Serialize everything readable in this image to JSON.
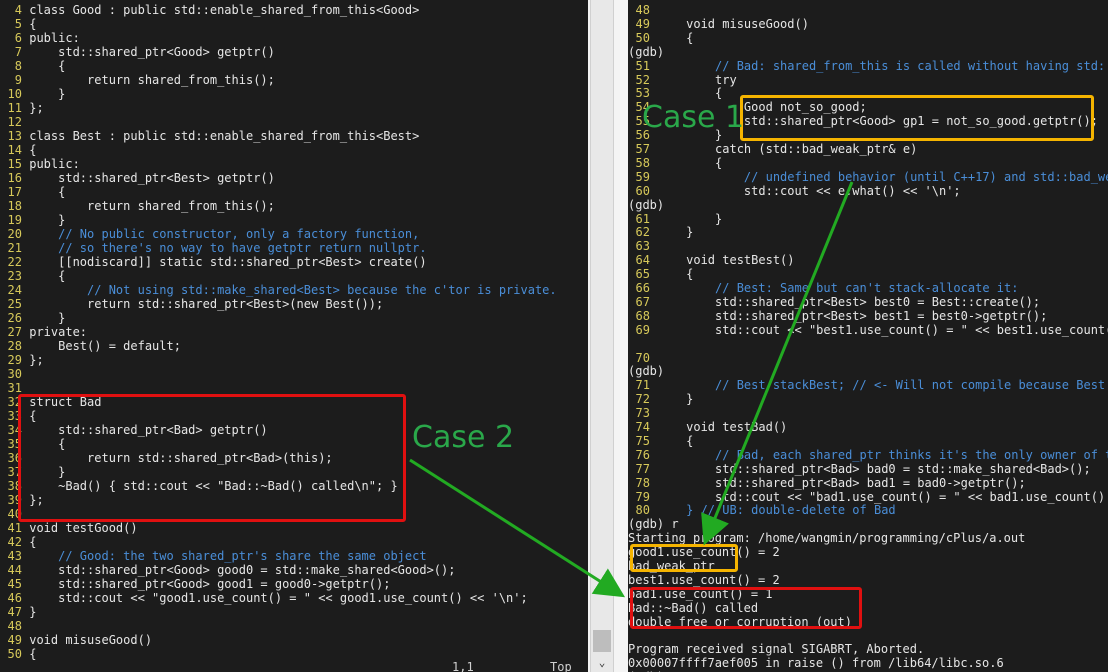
{
  "editor": {
    "lines": [
      {
        "n": "4",
        "t": "class Good : public std::enable_shared_from_this<Good>"
      },
      {
        "n": "5",
        "t": "{"
      },
      {
        "n": "6",
        "t": "public:"
      },
      {
        "n": "7",
        "t": "    std::shared_ptr<Good> getptr()"
      },
      {
        "n": "8",
        "t": "    {"
      },
      {
        "n": "9",
        "t": "        return shared_from_this();"
      },
      {
        "n": "10",
        "t": "    }"
      },
      {
        "n": "11",
        "t": "};"
      },
      {
        "n": "12",
        "t": ""
      },
      {
        "n": "13",
        "t": "class Best : public std::enable_shared_from_this<Best>"
      },
      {
        "n": "14",
        "t": "{"
      },
      {
        "n": "15",
        "t": "public:"
      },
      {
        "n": "16",
        "t": "    std::shared_ptr<Best> getptr()"
      },
      {
        "n": "17",
        "t": "    {"
      },
      {
        "n": "18",
        "t": "        return shared_from_this();"
      },
      {
        "n": "19",
        "t": "    }"
      },
      {
        "n": "20",
        "t": "    // No public constructor, only a factory function,",
        "c": "cm"
      },
      {
        "n": "21",
        "t": "    // so there's no way to have getptr return nullptr.",
        "c": "cm"
      },
      {
        "n": "22",
        "t": "    [[nodiscard]] static std::shared_ptr<Best> create()"
      },
      {
        "n": "23",
        "t": "    {"
      },
      {
        "n": "24",
        "t": "        // Not using std::make_shared<Best> because the c'tor is private.",
        "c": "cm"
      },
      {
        "n": "25",
        "t": "        return std::shared_ptr<Best>(new Best());"
      },
      {
        "n": "26",
        "t": "    }"
      },
      {
        "n": "27",
        "t": "private:"
      },
      {
        "n": "28",
        "t": "    Best() = default;"
      },
      {
        "n": "29",
        "t": "};"
      },
      {
        "n": "30",
        "t": ""
      },
      {
        "n": "31",
        "t": ""
      },
      {
        "n": "32",
        "t": "struct Bad"
      },
      {
        "n": "33",
        "t": "{"
      },
      {
        "n": "34",
        "t": "    std::shared_ptr<Bad> getptr()"
      },
      {
        "n": "35",
        "t": "    {"
      },
      {
        "n": "36",
        "t": "        return std::shared_ptr<Bad>(this);"
      },
      {
        "n": "37",
        "t": "    }"
      },
      {
        "n": "38",
        "t": "    ~Bad() { std::cout << \"Bad::~Bad() called\\n\"; }"
      },
      {
        "n": "39",
        "t": "};"
      },
      {
        "n": "40",
        "t": ""
      },
      {
        "n": "41",
        "t": "void testGood()"
      },
      {
        "n": "42",
        "t": "{"
      },
      {
        "n": "43",
        "t": "    // Good: the two shared_ptr's share the same object",
        "c": "cm"
      },
      {
        "n": "44",
        "t": "    std::shared_ptr<Good> good0 = std::make_shared<Good>();"
      },
      {
        "n": "45",
        "t": "    std::shared_ptr<Good> good1 = good0->getptr();"
      },
      {
        "n": "46",
        "t": "    std::cout << \"good1.use_count() = \" << good1.use_count() << '\\n';"
      },
      {
        "n": "47",
        "t": "}"
      },
      {
        "n": "48",
        "t": ""
      },
      {
        "n": "49",
        "t": "void misuseGood()"
      },
      {
        "n": "50",
        "t": "{"
      }
    ],
    "status_position": "1,1",
    "status_scroll": "Top"
  },
  "gdb": {
    "lines": [
      {
        "n": "48",
        "t": ""
      },
      {
        "n": "49",
        "t": "    void misuseGood()"
      },
      {
        "n": "50",
        "t": "    {"
      },
      {
        "n": "",
        "t": "(gdb)"
      },
      {
        "n": "51",
        "t": "        // Bad: shared_from_this is called without having std::s",
        "c": "cm"
      },
      {
        "n": "52",
        "t": "        try"
      },
      {
        "n": "53",
        "t": "        {"
      },
      {
        "n": "54",
        "t": "            Good not_so_good;"
      },
      {
        "n": "55",
        "t": "            std::shared_ptr<Good> gp1 = not_so_good.getptr();"
      },
      {
        "n": "56",
        "t": "        }"
      },
      {
        "n": "57",
        "t": "        catch (std::bad_weak_ptr& e)"
      },
      {
        "n": "58",
        "t": "        {"
      },
      {
        "n": "59",
        "t": "            // undefined behavior (until C++17) and std::bad_wea",
        "c": "cm"
      },
      {
        "n": "60",
        "t": "            std::cout << e.what() << '\\n';"
      },
      {
        "n": "",
        "t": "(gdb)"
      },
      {
        "n": "61",
        "t": "        }"
      },
      {
        "n": "62",
        "t": "    }"
      },
      {
        "n": "63",
        "t": ""
      },
      {
        "n": "64",
        "t": "    void testBest()"
      },
      {
        "n": "65",
        "t": "    {"
      },
      {
        "n": "66",
        "t": "        // Best: Same but can't stack-allocate it:",
        "c": "cm"
      },
      {
        "n": "67",
        "t": "        std::shared_ptr<Best> best0 = Best::create();"
      },
      {
        "n": "68",
        "t": "        std::shared_ptr<Best> best1 = best0->getptr();"
      },
      {
        "n": "69",
        "t": "        std::cout << \"best1.use_count() = \" << best1.use_count()"
      },
      {
        "n": "",
        "t": ""
      },
      {
        "n": "70",
        "t": ""
      },
      {
        "n": "",
        "t": "(gdb)"
      },
      {
        "n": "71",
        "t": "        // Best stackBest; // <- Will not compile because Best:",
        "c": "cm"
      },
      {
        "n": "72",
        "t": "    }"
      },
      {
        "n": "73",
        "t": ""
      },
      {
        "n": "74",
        "t": "    void testBad()"
      },
      {
        "n": "75",
        "t": "    {"
      },
      {
        "n": "76",
        "t": "        // Bad, each shared_ptr thinks it's the only owner of th",
        "c": "cm"
      },
      {
        "n": "77",
        "t": "        std::shared_ptr<Bad> bad0 = std::make_shared<Bad>();"
      },
      {
        "n": "78",
        "t": "        std::shared_ptr<Bad> bad1 = bad0->getptr();"
      },
      {
        "n": "79",
        "t": "        std::cout << \"bad1.use_count() = \" << bad1.use_count() <"
      },
      {
        "n": "80",
        "t": "    } // UB: double-delete of Bad",
        "c": "cm"
      },
      {
        "n": "",
        "t": "(gdb) r"
      },
      {
        "n": "",
        "t": "Starting program: /home/wangmin/programming/cPlus/a.out"
      },
      {
        "n": "",
        "t": "good1.use_count() = 2"
      },
      {
        "n": "",
        "t": "bad_weak_ptr"
      },
      {
        "n": "",
        "t": "best1.use_count() = 2"
      },
      {
        "n": "",
        "t": "bad1.use_count() = 1"
      },
      {
        "n": "",
        "t": "Bad::~Bad() called"
      },
      {
        "n": "",
        "t": "double free or corruption (out)"
      },
      {
        "n": "",
        "t": ""
      },
      {
        "n": "",
        "t": "Program received signal SIGABRT, Aborted."
      },
      {
        "n": "",
        "t": "0x00007ffff7aef005 in raise () from /lib64/libc.so.6"
      },
      {
        "n": "",
        "t": "(gdb) "
      }
    ]
  },
  "annotations": {
    "case1_label": "Case 1",
    "case2_label": "Case 2",
    "box_yellow": "#f5b400",
    "box_red": "#e01010",
    "arrow_green": "#22aa22"
  }
}
